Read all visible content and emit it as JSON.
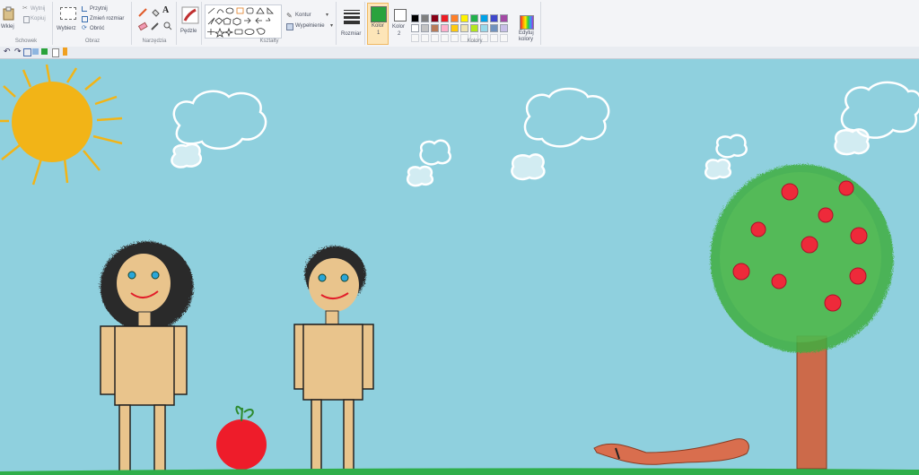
{
  "ribbon": {
    "clipboard": {
      "paste": "Wklej",
      "cut": "Wytnij",
      "copy": "Kopiuj",
      "group": "Schowek"
    },
    "image": {
      "select": "Wybierz",
      "crop": "Przytnij",
      "resize": "Zmień rozmiar",
      "rotate": "Obróć",
      "group": "Obraz"
    },
    "tools": {
      "group": "Narzędzia"
    },
    "brushes": {
      "label": "Pędzle"
    },
    "shapes": {
      "outline": "Kontur",
      "fill": "Wypełnienie",
      "group": "Kształty"
    },
    "size": {
      "label": "Rozmiar"
    },
    "color1": {
      "label": "Kolor",
      "sub": "1",
      "color": "#29a33d"
    },
    "color2": {
      "label": "Kolor",
      "sub": "2",
      "color": "#ffffff"
    },
    "edit_colors": {
      "line1": "Edytuj",
      "line2": "kolory"
    },
    "colors_group": "Kolory",
    "palette": [
      "#000000",
      "#7f7f7f",
      "#880015",
      "#ed1c24",
      "#ff7f27",
      "#fff200",
      "#22b14c",
      "#00a2e8",
      "#3f48cc",
      "#a349a4",
      "#ffffff",
      "#c3c3c3",
      "#b97a57",
      "#ffaec9",
      "#ffc90e",
      "#efe4b0",
      "#b5e61d",
      "#99d9ea",
      "#7092be",
      "#c8bfe7"
    ]
  },
  "canvas_colors": {
    "sky": "#8fd0de",
    "sun": "#f2b417",
    "skin": "#e9c48c",
    "apple": "#ee1c2a",
    "tree": "#3fae3f",
    "trunk": "#cc6a4a",
    "ground": "#2fae4a"
  }
}
